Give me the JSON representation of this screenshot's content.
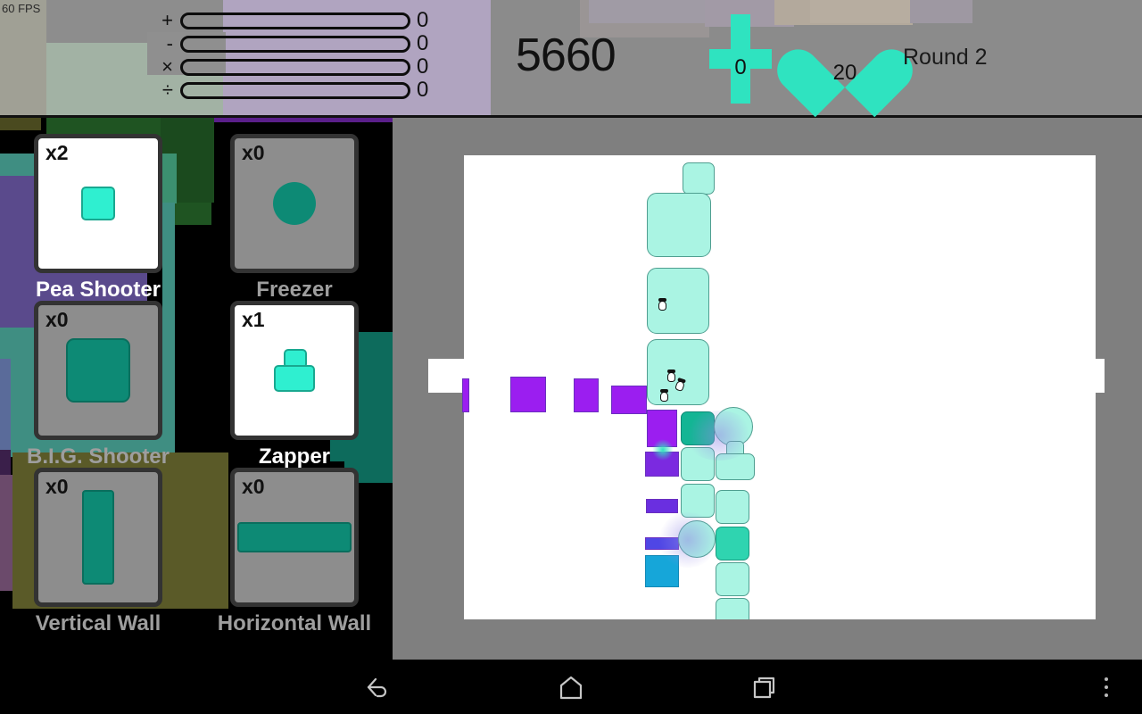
{
  "hud": {
    "fps": "60 FPS",
    "score": "5660",
    "money": "0",
    "lives": "20",
    "round": "Round 2",
    "meters": [
      {
        "symbol": "+",
        "value": "0",
        "fill_pct": 0
      },
      {
        "symbol": "-",
        "value": "0",
        "fill_pct": 0
      },
      {
        "symbol": "×",
        "value": "0",
        "fill_pct": 0
      },
      {
        "symbol": "÷",
        "value": "0",
        "fill_pct": 0
      }
    ],
    "colors": {
      "accent": "#2fe3c0",
      "bar": "#8b8b8b",
      "text": "#111111"
    }
  },
  "towers": [
    {
      "name": "Pea Shooter",
      "count": "x2",
      "state": "active",
      "icon": "small-square-icon"
    },
    {
      "name": "Freezer",
      "count": "x0",
      "state": "inactive",
      "icon": "circle-icon"
    },
    {
      "name": "B.I.G. Shooter",
      "count": "x0",
      "state": "inactive",
      "icon": "big-square-icon"
    },
    {
      "name": "Zapper",
      "count": "x1",
      "state": "active",
      "icon": "zapper-icon"
    },
    {
      "name": "Vertical Wall",
      "count": "x0",
      "state": "inactive",
      "icon": "vertical-bar-icon"
    },
    {
      "name": "Horizontal Wall",
      "count": "x0",
      "state": "inactive",
      "icon": "horizontal-bar-icon"
    }
  ],
  "navbar": {
    "back": "back-button",
    "home": "home-button",
    "recents": "recents-button",
    "overflow": "overflow-menu-button"
  },
  "field": {
    "board_color": "#ffffff",
    "wall_color": "#7f7f7f",
    "enemy_color": "#9b1ef0",
    "tower_color": "#aaf4e3",
    "entrance_side": "left",
    "exit_side": "right"
  },
  "colors": {
    "teal_light": "#aaf4e3",
    "teal_mid": "#2fd4b0",
    "teal_dark": "#0d8a75",
    "purple": "#9b1ef0",
    "panel_gray": "#8d8d8d"
  }
}
